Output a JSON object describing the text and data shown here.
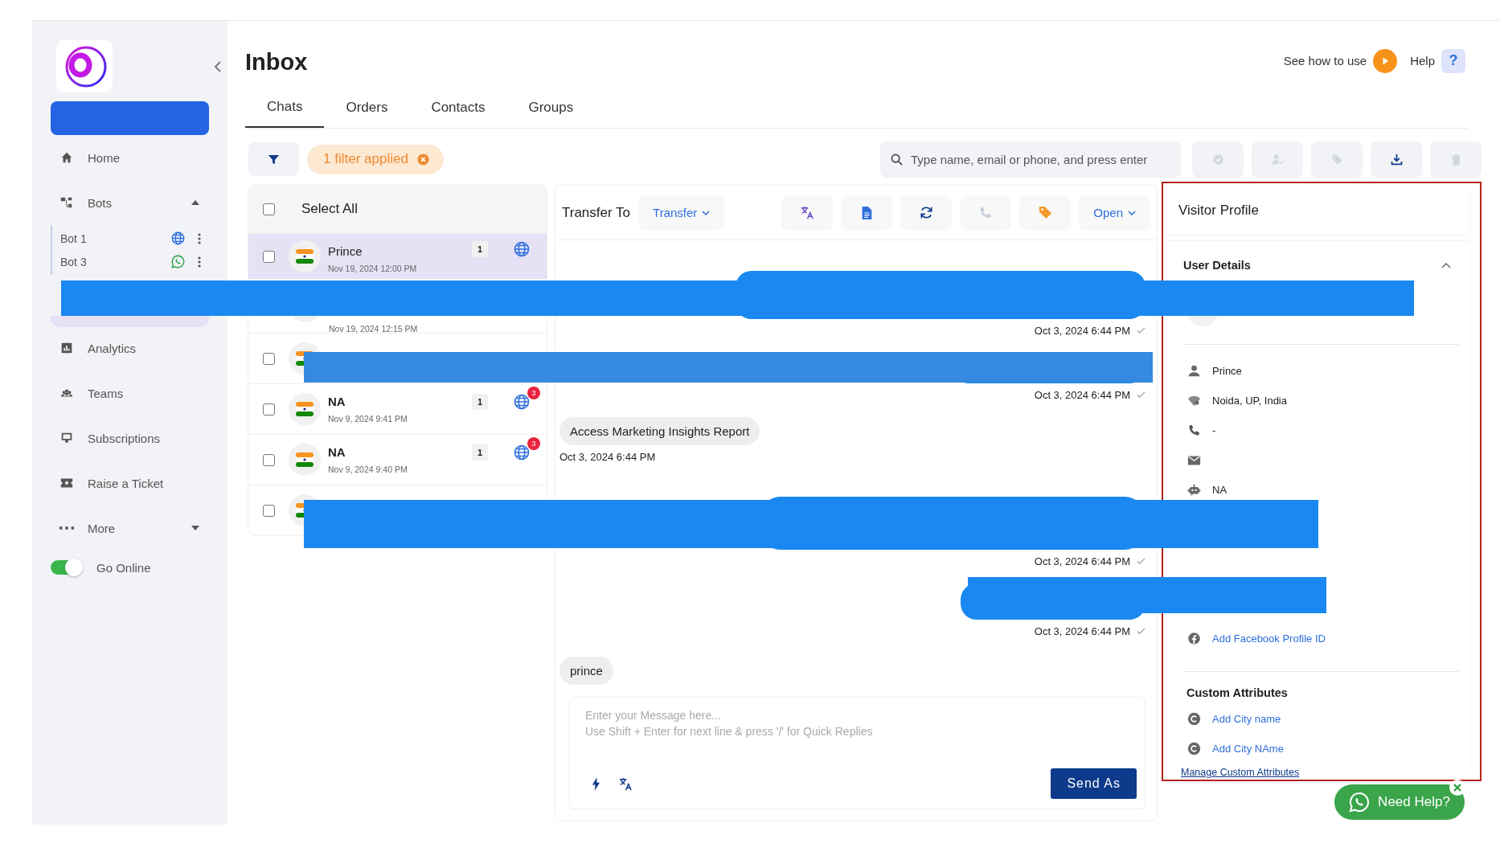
{
  "sidebar": {
    "items": [
      {
        "kind": "home",
        "label": "Home",
        "selected": false
      },
      {
        "kind": "bots",
        "label": "Bots",
        "selected": false,
        "expanded": true
      },
      {
        "kind": "inbox",
        "selected": true
      },
      {
        "kind": "analytics",
        "label": "Analytics",
        "selected": false
      },
      {
        "kind": "teams",
        "label": "Teams",
        "selected": false
      },
      {
        "kind": "subscriptions",
        "label": "Subscriptions",
        "selected": false
      },
      {
        "kind": "ticket",
        "label": "Raise a Ticket",
        "selected": false
      },
      {
        "kind": "more",
        "label": "More",
        "selected": false,
        "expanded": false
      }
    ],
    "bots": [
      {
        "label": "Bot 1",
        "kind": "web"
      },
      {
        "label": "Bot 3",
        "kind": "whatsapp"
      }
    ],
    "go_online": {
      "label": "Go Online",
      "on": true
    }
  },
  "header": {
    "title": "Inbox",
    "tutorial": "See how to use",
    "help": "Help",
    "help_icon": "?"
  },
  "tabs": [
    {
      "label": "Chats",
      "selected": true
    },
    {
      "label": "Orders",
      "selected": false
    },
    {
      "label": "Contacts",
      "selected": false
    },
    {
      "label": "Groups",
      "selected": false
    }
  ],
  "toolbar": {
    "filter_chip": "1 filter applied",
    "search": {
      "placeholder": "Type name, email or phone, and press enter"
    },
    "actions": [
      {
        "kind": "check",
        "disabled": true
      },
      {
        "kind": "assign",
        "disabled": true
      },
      {
        "kind": "tag",
        "disabled": true
      },
      {
        "kind": "download",
        "disabled": false
      },
      {
        "kind": "delete",
        "disabled": true
      }
    ]
  },
  "chat_list": {
    "select_all": {
      "label": "Select All",
      "checked": false
    },
    "rows": [
      {
        "name": "Prince",
        "time": "Nov 19, 2024 12:00 PM",
        "count": "1",
        "kind": "web",
        "selected": true,
        "checked": false
      },
      {
        "time": "Nov 19, 2024 12:15 PM",
        "selected": false
      },
      {
        "selected": false,
        "checked": false
      },
      {
        "name": "NA",
        "time": "Nov 9, 2024 9:41 PM",
        "count": "1",
        "kind": "web",
        "unread": "3",
        "selected": false,
        "checked": false
      },
      {
        "name": "NA",
        "time": "Nov 9, 2024 9:40 PM",
        "count": "1",
        "kind": "web",
        "unread": "3",
        "selected": false,
        "checked": false
      },
      {
        "selected": false,
        "checked": false
      }
    ]
  },
  "chat": {
    "transfer_label": "Transfer To",
    "transfer_dropdown": "Transfer",
    "tools": [
      {
        "kind": "translate",
        "disabled": false
      },
      {
        "kind": "document",
        "disabled": false
      },
      {
        "kind": "refresh",
        "disabled": false
      },
      {
        "kind": "call",
        "disabled": true
      },
      {
        "kind": "tag",
        "disabled": false
      }
    ],
    "status_dropdown": "Open",
    "messages": [
      {
        "kind": "out",
        "time": "Oct 3, 2024 6:44 PM"
      },
      {
        "kind": "out",
        "time": "Oct 3, 2024 6:44 PM"
      },
      {
        "kind": "in",
        "text": "Access Marketing Insights Report",
        "time": "Oct 3, 2024 6:44 PM"
      },
      {
        "kind": "out",
        "time": "Oct 3, 2024 6:44 PM"
      },
      {
        "kind": "out",
        "time": "Oct 3, 2024 6:44 PM"
      },
      {
        "kind": "in",
        "text": "prince"
      }
    ],
    "composer": {
      "placeholder": "Enter your Message here...\nUse Shift + Enter for next line & press '/' for Quick Replies",
      "send": "Send As"
    }
  },
  "profile": {
    "title": "Visitor Profile",
    "section": "User Details",
    "expanded": true,
    "details": [
      {
        "kind": "person",
        "text": "Prince"
      },
      {
        "kind": "location",
        "text": "Noida, UP, India"
      },
      {
        "kind": "phone",
        "text": "-"
      },
      {
        "kind": "email"
      },
      {
        "kind": "bot",
        "text": "NA"
      },
      {
        "kind": "facebook",
        "text": "Add Facebook Profile ID"
      }
    ],
    "custom_title": "Custom Attributes",
    "custom": [
      {
        "text": "Add City name"
      },
      {
        "text": "Add City NAme"
      }
    ],
    "manage_link": "Manage Custom Attributes"
  },
  "help_widget": {
    "label": "Need Help?"
  }
}
